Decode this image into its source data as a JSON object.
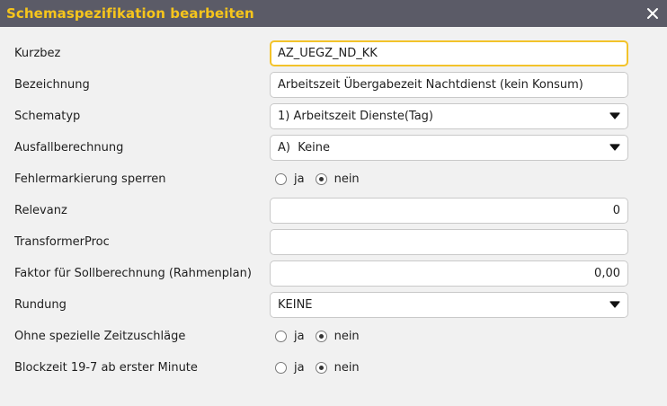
{
  "dialog": {
    "title": "Schemaspezifikation bearbeiten",
    "close_icon": "close-icon"
  },
  "fields": {
    "kurzbez": {
      "label": "Kurzbez",
      "value": "AZ_UEGZ_ND_KK"
    },
    "bezeichnung": {
      "label": "Bezeichnung",
      "value": "Arbeitszeit Übergabezeit Nachtdienst (kein Konsum)"
    },
    "schematyp": {
      "label": "Schematyp",
      "value": "1) Arbeitszeit Dienste(Tag)"
    },
    "ausfallberechnung": {
      "label": "Ausfallberechnung",
      "value": "A)  Keine"
    },
    "fehlermarkierung": {
      "label": "Fehlermarkierung sperren",
      "opt_ja": "ja",
      "opt_nein": "nein",
      "selected": "nein"
    },
    "relevanz": {
      "label": "Relevanz",
      "value": "0"
    },
    "transformerproc": {
      "label": "TransformerProc",
      "value": ""
    },
    "faktor": {
      "label": "Faktor für Sollberechnung (Rahmenplan)",
      "value": "0,00"
    },
    "rundung": {
      "label": "Rundung",
      "value": "KEINE"
    },
    "zeitzuschlaege": {
      "label": "Ohne spezielle Zeitzuschläge",
      "opt_ja": "ja",
      "opt_nein": "nein",
      "selected": "nein"
    },
    "blockzeit": {
      "label": "Blockzeit 19-7 ab erster Minute",
      "opt_ja": "ja",
      "opt_nein": "nein",
      "selected": "nein"
    }
  },
  "colors": {
    "titlebar": "#5b5b67",
    "title_text": "#f6c51c",
    "focus_border": "#f3c32a",
    "background": "#f1f1f1"
  }
}
